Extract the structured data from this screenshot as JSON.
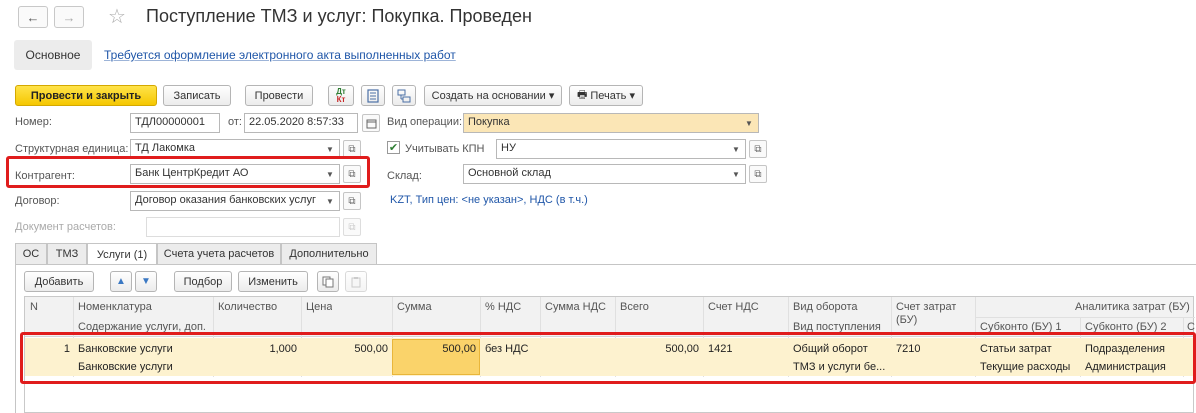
{
  "header": {
    "title": "Поступление ТМЗ и услуг: Покупка. Проведен",
    "back_glyph": "←",
    "forward_glyph": "→",
    "star_glyph": "☆"
  },
  "subtabs": {
    "main": "Основное",
    "link": "Требуется оформление электронного акта выполненных работ"
  },
  "toolbar": {
    "post_close": "Провести и закрыть",
    "save": "Записать",
    "post": "Провести",
    "dtkt_top": "Дт",
    "dtkt_bottom": "Кт",
    "create_basis": "Создать на основании ▾",
    "print": "Печать ▾"
  },
  "form": {
    "number_label": "Номер:",
    "number": "ТДЛ00000001",
    "date_label": "от:",
    "date": "22.05.2020 8:57:33",
    "optype_label": "Вид операции:",
    "optype": "Покупка",
    "unit_label": "Структурная единица:",
    "unit": "ТД Лакомка",
    "kpn_label": "Учитывать КПН",
    "kpn": "НУ",
    "contractor_label": "Контрагент:",
    "contractor": "Банк ЦентрКредит АО",
    "warehouse_label": "Склад:",
    "warehouse": "Основной склад",
    "contract_label": "Договор:",
    "contract": "Договор оказания банковских услуг",
    "price_info": "KZT, Тип цен: <не указан>, НДС (в т.ч.)",
    "settlement_doc_label": "Документ расчетов:",
    "settlement_doc": ""
  },
  "tabs": [
    "ОС",
    "ТМЗ",
    "Услуги (1)",
    "Счета учета расчетов",
    "Дополнительно"
  ],
  "table_toolbar": {
    "add": "Добавить",
    "up": "▲",
    "down": "▼",
    "select": "Подбор",
    "change": "Изменить"
  },
  "table": {
    "headers": {
      "n": "N",
      "nom": "Номенклатура",
      "nom2": "Содержание услуги, доп.",
      "qty": "Количество",
      "price": "Цена",
      "sum": "Сумма",
      "vat_pct": "% НДС",
      "vat_sum": "Сумма НДС",
      "total": "Всего",
      "vat_acc": "Счет НДС",
      "turnover": "Вид оборота",
      "turnover2": "Вид поступления",
      "cost_acc": "Счет затрат",
      "cost_acc2": "(БУ)",
      "analytics": "Аналитика затрат (БУ)",
      "sub1": "Субконто (БУ) 1",
      "sub2": "Субконто (БУ) 2",
      "sub3": "С"
    },
    "rows": [
      {
        "n": "1",
        "nom": "Банковские услуги",
        "nom2": "Банковские услуги",
        "qty": "1,000",
        "price": "500,00",
        "sum": "500,00",
        "vat_pct": "без НДС",
        "vat_sum": "",
        "total": "500,00",
        "vat_acc": "1421",
        "turnover": "Общий оборот",
        "turnover2": "ТМЗ и услуги бе...",
        "cost_acc": "7210",
        "sub1": "Статьи затрат",
        "sub1b": "Текущие расходы",
        "sub2": "Подразделения",
        "sub2b": "Администрация"
      }
    ]
  },
  "colors": {
    "primary": "#f5c700",
    "highlight": "#e01c1c",
    "link": "#1f56a8",
    "selected_row": "#fdf2cf"
  }
}
